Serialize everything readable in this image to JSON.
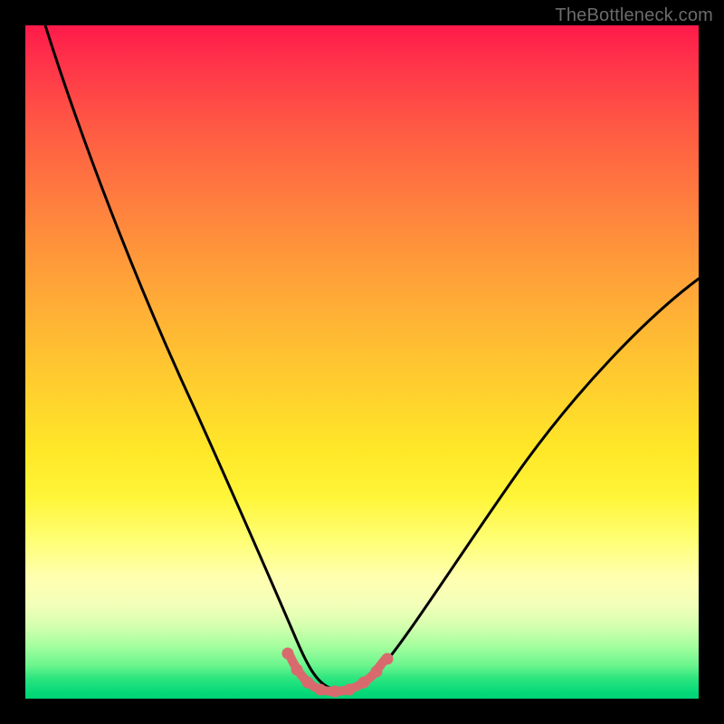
{
  "watermark": "TheBottleneck.com",
  "chart_data": {
    "type": "line",
    "title": "",
    "xlabel": "",
    "ylabel": "",
    "xlim": [
      0,
      100
    ],
    "ylim": [
      0,
      100
    ],
    "background_gradient": {
      "top_color": "#ff1a4b",
      "mid_color": "#ffe728",
      "bottom_color": "#00d276"
    },
    "series": [
      {
        "name": "bottleneck-curve",
        "color": "#000000",
        "stroke_width": 3,
        "x": [
          3,
          6,
          10,
          14,
          18,
          22,
          26,
          30,
          33,
          35,
          37,
          39,
          41,
          43,
          45,
          47,
          49,
          52,
          56,
          60,
          65,
          70,
          76,
          82,
          88,
          94,
          100
        ],
        "y": [
          100,
          92,
          82,
          72,
          63,
          54,
          45,
          36,
          29,
          23,
          18,
          13,
          9,
          5,
          3,
          2,
          2,
          3,
          6,
          10,
          16,
          23,
          31,
          39,
          47,
          54,
          62
        ]
      },
      {
        "name": "bottom-highlight",
        "color": "#d86a6e",
        "type": "scatter_line",
        "marker_radius": 6,
        "stroke_width": 9,
        "x": [
          38,
          40,
          42,
          44,
          46,
          48,
          50,
          52
        ],
        "y": [
          9,
          5,
          3,
          2,
          2,
          2,
          3,
          5
        ]
      }
    ],
    "annotations": []
  }
}
